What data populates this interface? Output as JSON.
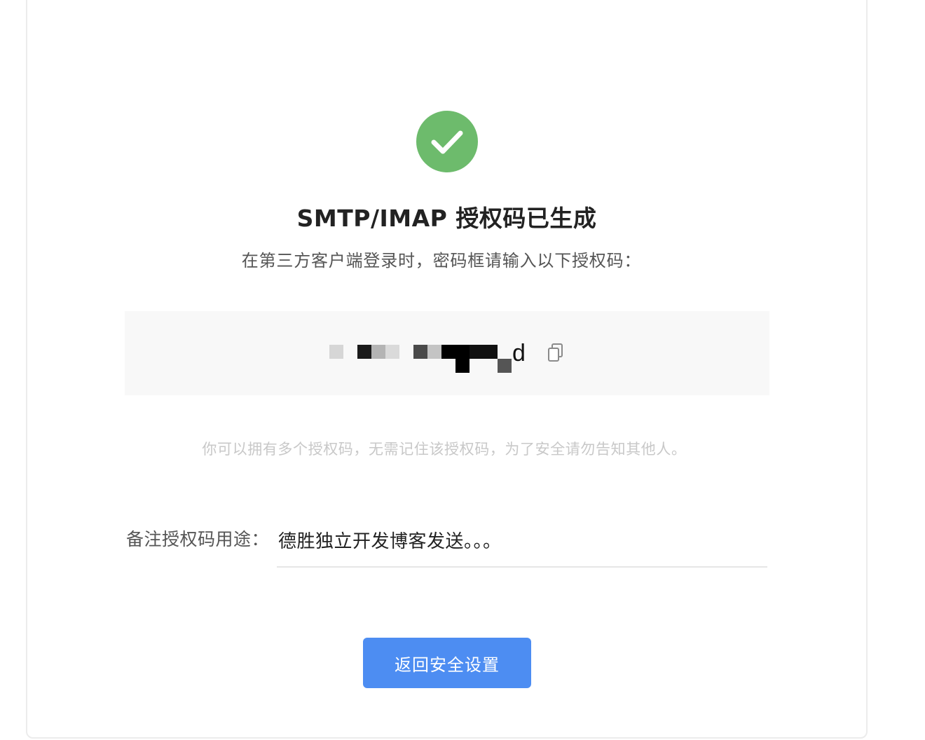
{
  "status": {
    "icon": "check-circle-icon",
    "color": "#6dbb6c"
  },
  "title": "SMTP/IMAP 授权码已生成",
  "subtitle": "在第三方客户端登录时，密码框请输入以下授权码：",
  "auth_code": {
    "visible_tail": "d",
    "copy_icon": "copy-icon",
    "note": "code characters are pixelated/redacted"
  },
  "hint": "你可以拥有多个授权码，无需记住该授权码，为了安全请勿告知其他人。",
  "note": {
    "label": "备注授权码用途：",
    "value": "德胜独立开发博客发送。。。"
  },
  "back_button": {
    "label": "返回安全设置",
    "color": "#4d8df2"
  }
}
